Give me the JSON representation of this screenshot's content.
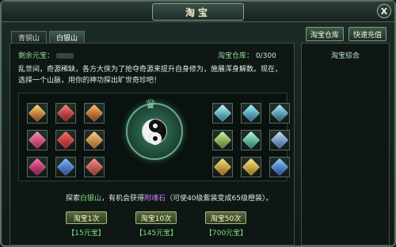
{
  "window": {
    "title": "淘宝"
  },
  "tabs": [
    {
      "label": "青铜山",
      "active": false
    },
    {
      "label": "白银山",
      "active": true
    }
  ],
  "top_buttons": [
    {
      "label": "淘宝仓库"
    },
    {
      "label": "快速充值"
    }
  ],
  "info": {
    "remaining_label": "剩余元宝：",
    "warehouse_label": "淘宝仓库：",
    "warehouse_value": "0/300"
  },
  "description": "乱世间，奇源稀缺，各方大侠为了抢夺奇源来提升自身修为，施展浑身解数。现在，选择一个山脉，用你的神功探出旷世奇珍吧！",
  "explore": {
    "prefix": "探索",
    "mountain": "白银山",
    "middle": "，有机会获得",
    "item": "附魂石",
    "suffix": "（可使40级紫装变成65级橙装）。"
  },
  "actions": [
    {
      "label": "淘宝1次",
      "price": "【15元宝】"
    },
    {
      "label": "淘宝10次",
      "price": "【145元宝】"
    },
    {
      "label": "淘宝50次",
      "price": "【700元宝】"
    }
  ],
  "side_panel": {
    "title": "淘宝综合"
  },
  "icons": {
    "close": "close-icon",
    "center": "yin-yang-disc-icon"
  },
  "colors": {
    "accent_green": "#7fe07f",
    "item_purple": "#d27bff",
    "border": "#5b6f5e"
  }
}
